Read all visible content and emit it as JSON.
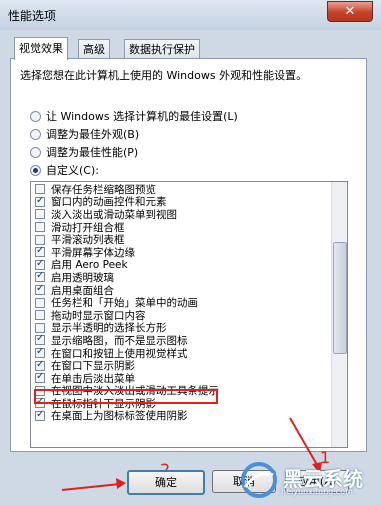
{
  "window": {
    "title": "性能选项",
    "close_glyph": "✕"
  },
  "tabs": [
    {
      "label": "视觉效果",
      "active": true
    },
    {
      "label": "高级",
      "active": false
    },
    {
      "label": "数据执行保护",
      "active": false
    }
  ],
  "description": "选择您想在此计算机上使用的 Windows 外观和性能设置。",
  "radios": [
    {
      "label": "让 Windows 选择计算机的最佳设置(L)",
      "selected": false
    },
    {
      "label": "调整为最佳外观(B)",
      "selected": false
    },
    {
      "label": "调整为最佳性能(P)",
      "selected": false
    },
    {
      "label": "自定义(C):",
      "selected": true
    }
  ],
  "effects": [
    {
      "label": "保存任务栏缩略图预览",
      "checked": false
    },
    {
      "label": "窗口内的动画控件和元素",
      "checked": true
    },
    {
      "label": "淡入淡出或滑动菜单到视图",
      "checked": false
    },
    {
      "label": "滑动打开组合框",
      "checked": false
    },
    {
      "label": "平滑滚动列表框",
      "checked": false
    },
    {
      "label": "平滑屏幕字体边缘",
      "checked": true
    },
    {
      "label": "启用 Aero Peek",
      "checked": true
    },
    {
      "label": "启用透明玻璃",
      "checked": true
    },
    {
      "label": "启用桌面组合",
      "checked": true
    },
    {
      "label": "任务栏和「开始」菜单中的动画",
      "checked": false
    },
    {
      "label": "拖动时显示窗口内容",
      "checked": false
    },
    {
      "label": "显示半透明的选择长方形",
      "checked": false
    },
    {
      "label": "显示缩略图，而不是显示图标",
      "checked": true
    },
    {
      "label": "在窗口和按钮上使用视觉样式",
      "checked": true
    },
    {
      "label": "在窗口下显示阴影",
      "checked": true
    },
    {
      "label": "在单击后淡出菜单",
      "checked": true
    },
    {
      "label": "在视图中淡入淡出或滑动工具条提示",
      "checked": false
    },
    {
      "label": "在鼠标指针下显示阴影",
      "checked": true
    },
    {
      "label": "在桌面上为图标标签使用阴影",
      "checked": true
    }
  ],
  "buttons": {
    "ok": "确定",
    "cancel": "取消",
    "apply": "应用(A)"
  },
  "annotations": {
    "step1": "1",
    "step2": "2"
  },
  "watermark": {
    "brand": "黑云系统",
    "url": "heiyunxitong.com"
  },
  "colors": {
    "annotation": "#e0221a",
    "selected_check": "#1d3a6c"
  }
}
